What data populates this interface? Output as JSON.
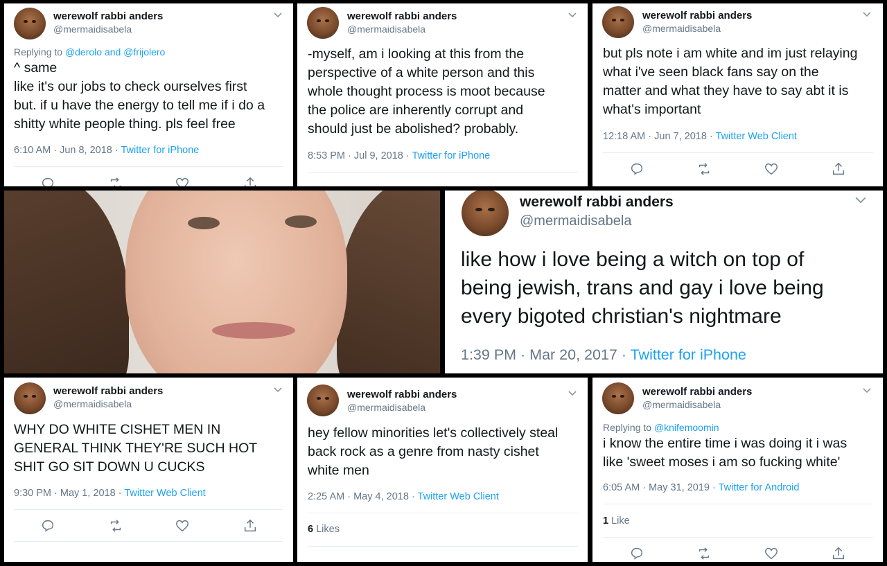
{
  "user": {
    "name": "werewolf rabbi anders",
    "handle": "@mermaidisabela"
  },
  "tweets": [
    {
      "reply_prefix": "Replying to ",
      "reply_to_1": "@derolo",
      "reply_and": " and ",
      "reply_to_2": "@frijolero",
      "lines": [
        "^ same",
        "like it's our jobs to check ourselves first",
        "but. if u have the energy to tell me if i do a",
        "shitty white people thing. pls feel free"
      ],
      "time": "6:10 AM · Jun 8, 2018 · ",
      "source": "Twitter for iPhone"
    },
    {
      "lines": [
        "-myself, am i looking at this from the",
        "perspective of a white person and this",
        "whole thought process is moot because",
        "the police are inherently corrupt and",
        "should just be abolished? probably."
      ],
      "time": "8:53 PM · Jul 9, 2018 · ",
      "source": "Twitter for iPhone"
    },
    {
      "lines": [
        "but pls note i am white and im just relaying",
        "what i've seen black fans say on the",
        "matter and what they have to say abt it is",
        "what's important"
      ],
      "time": "12:18 AM · Jun 7, 2018 · ",
      "source": "Twitter Web Client"
    },
    {
      "lines": [
        "like how i love being a witch on top of",
        "being jewish, trans and gay i love being",
        "every bigoted christian's nightmare"
      ],
      "time": "1:39 PM · Mar 20, 2017 · ",
      "source": "Twitter for iPhone"
    },
    {
      "lines": [
        "WHY DO WHITE CISHET MEN IN",
        "GENERAL THINK THEY'RE SUCH HOT",
        "SHIT GO SIT DOWN U CUCKS"
      ],
      "time": "9:30 PM · May 1, 2018 · ",
      "source": "Twitter Web Client"
    },
    {
      "lines": [
        "hey fellow minorities let's collectively steal",
        "back rock as a genre from nasty cishet",
        "white men"
      ],
      "time": "2:25 AM · May 4, 2018 · ",
      "source": "Twitter Web Client",
      "likes_count": "6",
      "likes_label": " Likes"
    },
    {
      "reply_prefix": "Replying to ",
      "reply_to_1": "@knifemoomin",
      "lines": [
        "i know the entire time i was doing it i was",
        "like 'sweet moses i am so fucking white'"
      ],
      "time": "6:05 AM · May 31, 2019 · ",
      "source": "Twitter for Android",
      "likes_count": "1",
      "likes_label": " Like"
    }
  ],
  "icons": [
    "reply-icon",
    "retweet-icon",
    "like-icon",
    "share-icon",
    "chevron-down-icon",
    "avatar"
  ],
  "colors": {
    "link": "#1da1f2",
    "muted": "#657786",
    "text": "#14171a",
    "border": "#000000"
  }
}
